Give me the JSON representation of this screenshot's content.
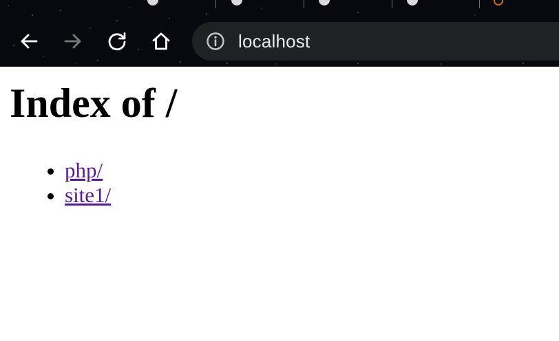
{
  "browser": {
    "address_bar": {
      "url": "localhost",
      "info_icon": "info-circle-icon"
    },
    "nav": {
      "back_icon": "arrow-left-icon",
      "forward_icon": "arrow-right-icon",
      "reload_icon": "reload-icon",
      "home_icon": "home-icon"
    },
    "colors": {
      "toolbar_bg": "#07090f",
      "omnibox_bg": "#202124",
      "omnibox_text": "#e8eaed",
      "nav_icon": "#ffffff",
      "nav_icon_disabled": "#7a7a7a"
    }
  },
  "page": {
    "heading": "Index of /",
    "entries": [
      {
        "label": "php/"
      },
      {
        "label": "site1/"
      }
    ],
    "colors": {
      "link_visited": "#551a8b",
      "text": "#000000",
      "background": "#ffffff"
    }
  }
}
